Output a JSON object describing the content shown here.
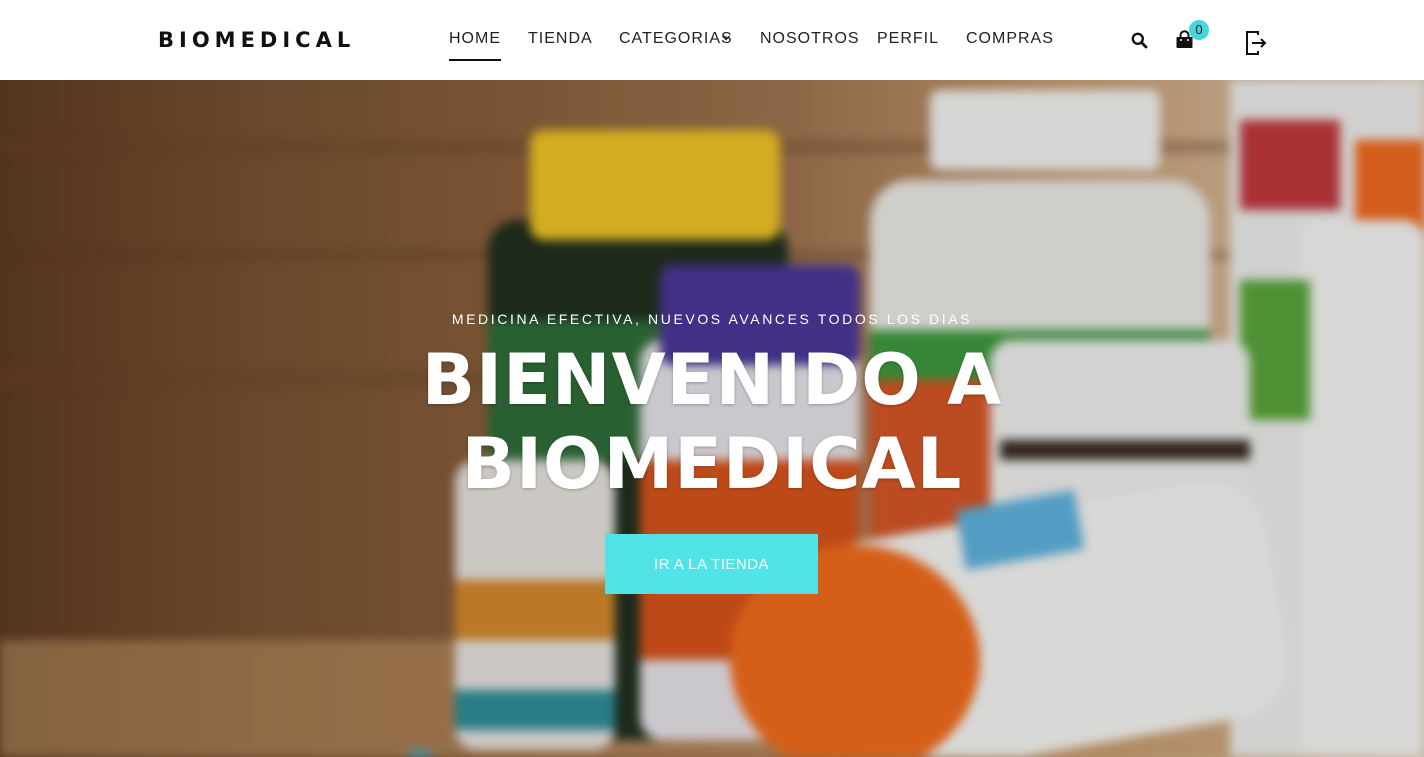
{
  "brand": {
    "name": "BIOMEDICAL"
  },
  "nav": {
    "items": [
      {
        "label": "HOME",
        "active": true
      },
      {
        "label": "TIENDA",
        "active": false
      },
      {
        "label": "CATEGORIAS",
        "active": false,
        "has_dropdown": true
      },
      {
        "label": "NOSOTROS",
        "active": false
      },
      {
        "label": "PERFIL",
        "active": false
      },
      {
        "label": "COMPRAS",
        "active": false
      }
    ]
  },
  "toolbar": {
    "search_icon": "search-icon",
    "cart_icon": "shopping-bag-icon",
    "cart_count": "0",
    "logout_icon": "logout-icon"
  },
  "hero": {
    "tagline": "MEDICINA EFECTIVA, NUEVOS AVANCES TODOS LOS DIAS",
    "title_line1": "BIENVENIDO A",
    "title_line2": "BIOMEDICAL",
    "cta_label": "IR A LA TIENDA"
  },
  "colors": {
    "accent": "#52e3e6",
    "badge": "#43d7dd",
    "text_dark": "#111111",
    "header_bg": "#ffffff"
  }
}
